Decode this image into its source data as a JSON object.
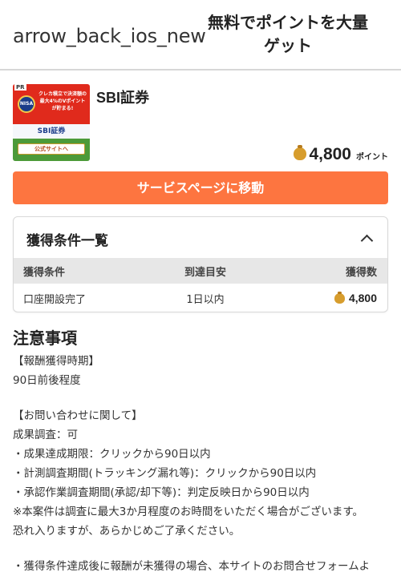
{
  "header": {
    "back_icon_text": "arrow_back_ios_new",
    "title": "無料でポイントを大量ゲット"
  },
  "banner": {
    "pr": "PR",
    "nisa": "NISA",
    "copy": "クレカ積立で決済額の最大4%のVポイントが貯まる!",
    "logo": "SBI証券",
    "button": "公式サイトへ"
  },
  "service": {
    "name": "SBI証券",
    "reward_value": "4,800",
    "reward_unit": "ポイント"
  },
  "cta": {
    "label": "サービスページに移動"
  },
  "conditions": {
    "title": "獲得条件一覧",
    "columns": [
      "獲得条件",
      "到達目安",
      "獲得数"
    ],
    "rows": [
      {
        "condition": "口座開設完了",
        "estimate": "1日以内",
        "reward": "4,800"
      }
    ]
  },
  "notes": {
    "title": "注意事項",
    "lines": [
      "【報酬獲得時期】",
      "90日前後程度",
      "",
      "【お問い合わせに関して】",
      "成果調査：可",
      "・成果達成期限：クリックから90日以内",
      "・計測調査期間(トラッキング漏れ等)：クリックから90日以内",
      "・承認作業調査期間(承認/却下等)：判定反映日から90日以内",
      "※本案件は調査に最大3か月程度のお時間をいただく場合がございます。",
      "恐れ入りますが、あらかじめご了承ください。",
      "",
      "・獲得条件達成後に報酬が未獲得の場合、本サイトのお問合せフォームよ"
    ]
  }
}
